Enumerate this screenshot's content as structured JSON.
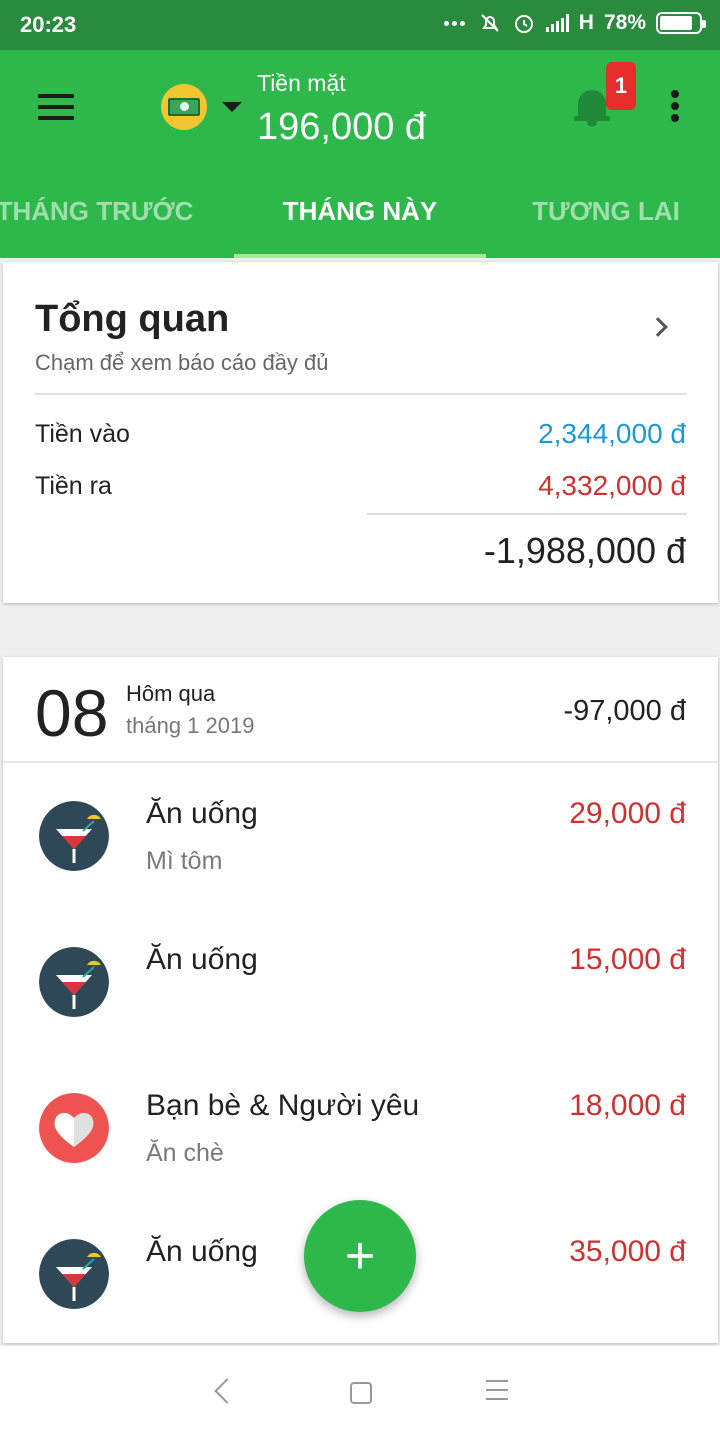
{
  "status_bar": {
    "time": "20:23",
    "network": "H",
    "battery": "78%"
  },
  "header": {
    "wallet_name": "Tiền mặt",
    "wallet_balance": "196,000 đ",
    "notification_count": "1"
  },
  "tabs": [
    {
      "label": "THÁNG TRƯỚC"
    },
    {
      "label": "THÁNG NÀY"
    },
    {
      "label": "TƯƠNG LAI"
    }
  ],
  "overview": {
    "title": "Tổng quan",
    "subtitle": "Chạm để xem báo cáo đầy đủ",
    "income_label": "Tiền vào",
    "income_value": "2,344,000 đ",
    "expense_label": "Tiền ra",
    "expense_value": "4,332,000 đ",
    "net_value": "-1,988,000 đ"
  },
  "day_group": {
    "day": "08",
    "label": "Hôm qua",
    "month_year": "tháng 1 2019",
    "total": "-97,000 đ",
    "transactions": [
      {
        "category": "Ăn uống",
        "note": "Mì tôm",
        "amount": "29,000 đ",
        "icon": "cocktail-icon"
      },
      {
        "category": "Ăn uống",
        "note": "",
        "amount": "15,000 đ",
        "icon": "cocktail-icon"
      },
      {
        "category": "Bạn bè & Người yêu",
        "note": "Ăn chè",
        "amount": "18,000 đ",
        "icon": "heart-icon"
      },
      {
        "category": "Ăn uống",
        "note": "",
        "amount": "35,000 đ",
        "icon": "cocktail-icon"
      }
    ]
  },
  "fab": {
    "label": "+"
  },
  "colors": {
    "primary": "#2eb84b",
    "status_bar": "#2a8a3e",
    "income": "#1a9ad6",
    "expense": "#d03030",
    "badge": "#e52d2d"
  }
}
